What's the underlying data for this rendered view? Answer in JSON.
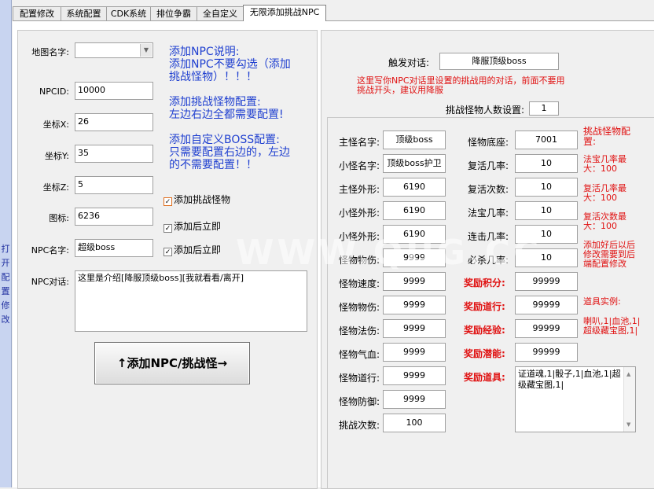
{
  "sidebar": {
    "label": "打开配置修改"
  },
  "tabs": [
    {
      "label": "配置修改"
    },
    {
      "label": "系统配置"
    },
    {
      "label": "CDK系统"
    },
    {
      "label": "排位争霸"
    },
    {
      "label": "全自定义"
    },
    {
      "label": "无限添加挑战NPC"
    }
  ],
  "left": {
    "map_label": "地图名字:",
    "map_value": "",
    "npcid_label": "NPCID:",
    "npcid_value": "10000",
    "x_label": "坐标X:",
    "x_value": "26",
    "y_label": "坐标Y:",
    "y_value": "35",
    "z_label": "坐标Z:",
    "z_value": "5",
    "icon_label": "图标:",
    "icon_value": "6236",
    "name_label": "NPC名字:",
    "name_value": "超级boss",
    "dialog_label": "NPC对话:",
    "dialog_value": "这里是介绍[降服顶级boss][我就看看/离开]",
    "help": [
      "添加NPC说明:",
      "添加NPC不要勾选（添加",
      "挑战怪物）！！！",
      "",
      "添加挑战怪物配置:",
      "左边右边全都需要配置!",
      "",
      "添加自定义BOSS配置:",
      "只需要配置右边的，左边",
      "的不需要配置！！"
    ],
    "chk_monster": "添加挑战怪物",
    "chk_now1": "添加后立即",
    "chk_now2": "添加后立即",
    "add_button": "↑添加NPC/挑战怪→"
  },
  "right": {
    "trigger_label": "触发对话:",
    "trigger_value": "降服顶级boss",
    "trigger_note": "这里写你NPC对话里设置的挑战用的对话，前面不要用挑战开头，建议用降服",
    "count_label": "挑战怪物人数设置:",
    "count_value": "1",
    "col1": [
      {
        "label": "主怪名字:",
        "value": "顶级boss"
      },
      {
        "label": "小怪名字:",
        "value": "顶级boss护卫"
      },
      {
        "label": "主怪外形:",
        "value": "6190"
      },
      {
        "label": "小怪外形:",
        "value": "6190"
      },
      {
        "label": "小怪外形:",
        "value": "6190"
      },
      {
        "label": "怪物物伤:",
        "value": "9999"
      },
      {
        "label": "怪物速度:",
        "value": "9999"
      },
      {
        "label": "怪物物伤:",
        "value": "9999"
      },
      {
        "label": "怪物法伤:",
        "value": "9999"
      },
      {
        "label": "怪物气血:",
        "value": "9999"
      },
      {
        "label": "怪物道行:",
        "value": "9999"
      },
      {
        "label": "怪物防御:",
        "value": "9999"
      },
      {
        "label": "挑战次数:",
        "value": "100"
      }
    ],
    "col2": [
      {
        "label": "怪物底座:",
        "value": "7001"
      },
      {
        "label": "复活几率:",
        "value": "10"
      },
      {
        "label": "复活次数:",
        "value": "10"
      },
      {
        "label": "法宝几率:",
        "value": "10"
      },
      {
        "label": "连击几率:",
        "value": "10"
      },
      {
        "label": "必杀几率:",
        "value": "10"
      }
    ],
    "rewards": [
      {
        "label": "奖励积分:",
        "value": "99999"
      },
      {
        "label": "奖励道行:",
        "value": "99999"
      },
      {
        "label": "奖励经验:",
        "value": "99999"
      },
      {
        "label": "奖励潜能:",
        "value": "99999"
      }
    ],
    "items_label": "奖励道具:",
    "items_value": "证道魂,1|骰子,1|血池,1|超级藏宝图,1|",
    "notes": {
      "n1": "挑战怪物配置:",
      "n2": "法宝几率最大：100",
      "n3": "复活几率最大：100",
      "n4": "复活次数最大：100",
      "n5": "添加好后以后修改需要到后端配置修改",
      "n6": "道具实例:",
      "n7": "喇叭,1|血池,1|超级藏宝图,1|"
    }
  },
  "watermark": "WWW.QUG.CC"
}
